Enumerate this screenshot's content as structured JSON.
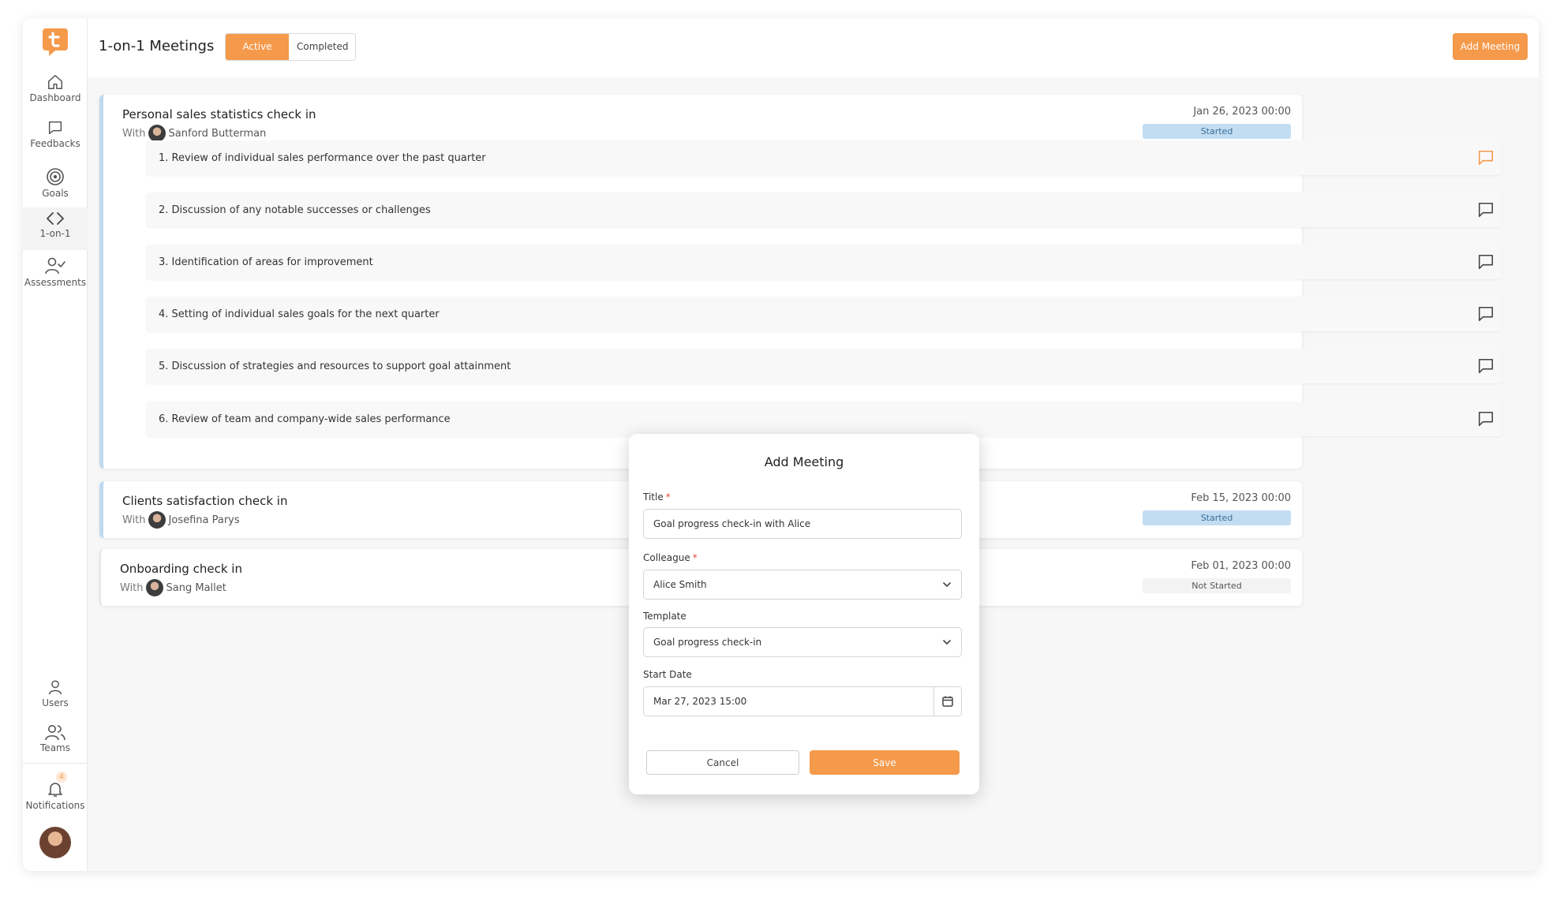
{
  "app": {
    "accent": "#f5994a"
  },
  "sidebar": {
    "items": [
      {
        "label": "Dashboard",
        "icon": "home-icon"
      },
      {
        "label": "Feedbacks",
        "icon": "chat-bubble-icon"
      },
      {
        "label": "Goals",
        "icon": "target-icon"
      },
      {
        "label": "1-on-1",
        "icon": "code-brackets-icon"
      },
      {
        "label": "Assessments",
        "icon": "user-check-icon"
      }
    ],
    "bottom": [
      {
        "label": "Users",
        "icon": "user-icon"
      },
      {
        "label": "Teams",
        "icon": "users-icon"
      },
      {
        "label": "Notifications",
        "icon": "bell-icon",
        "badge": "4"
      }
    ]
  },
  "header": {
    "title": "1-on-1 Meetings",
    "tabs": [
      {
        "label": "Active"
      },
      {
        "label": "Completed"
      }
    ],
    "add_button": "Add Meeting"
  },
  "meetings": [
    {
      "title": "Personal sales statistics check in",
      "with_label": "With",
      "person": "Sanford Butterman",
      "date": "Jan 26, 2023 00:00",
      "status": "Started",
      "agenda": [
        "1. Review of individual sales performance over the past quarter",
        "2. Discussion of any notable successes or challenges",
        "3. Identification of areas for improvement",
        "4. Setting of individual sales goals for the next quarter",
        "5. Discussion of strategies and resources to support goal attainment",
        "6. Review of team and company-wide sales performance"
      ]
    },
    {
      "title": "Clients satisfaction check in",
      "with_label": "With",
      "person": "Josefina Parys",
      "date": "Feb 15, 2023 00:00",
      "status": "Started"
    },
    {
      "title": "Onboarding check in",
      "with_label": "With",
      "person": "Sang Mallet",
      "date": "Feb 01, 2023 00:00",
      "status": "Not Started"
    }
  ],
  "modal": {
    "title": "Add Meeting",
    "title_label": "Title",
    "title_value": "Goal progress check-in with Alice",
    "colleague_label": "Colleague",
    "colleague_value": "Alice Smith",
    "template_label": "Template",
    "template_value": "Goal progress check-in",
    "start_label": "Start Date",
    "start_value": "Mar 27, 2023 15:00",
    "required_mark": "*",
    "cancel": "Cancel",
    "save": "Save"
  }
}
